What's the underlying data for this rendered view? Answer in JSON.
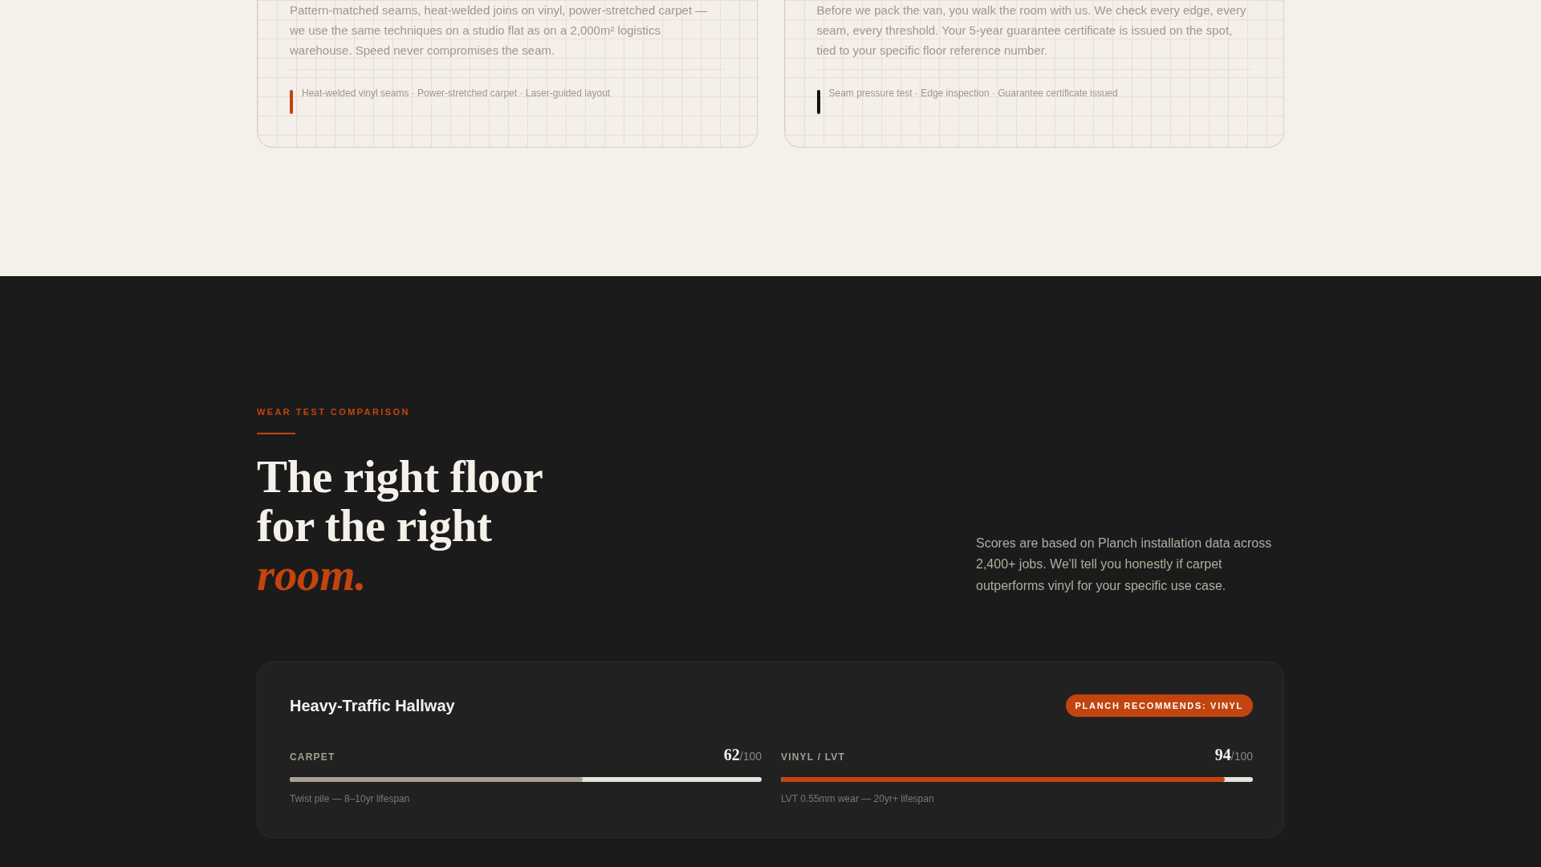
{
  "feature_cards": [
    {
      "text": "Pattern-matched seams, heat-welded joins on vinyl, power-stretched carpet — we use the same techniques on a studio flat as on a 2,000m² logistics warehouse. Speed never compromises the seam.",
      "highlights": "Heat-welded vinyl seams · Power-stretched carpet · Laser-guided layout",
      "color": "#c2440f"
    },
    {
      "text": "Before we pack the van, you walk the room with us. We check every edge, every seam, every threshold. Your 5-year guarantee certificate is issued on the spot, tied to your specific floor reference number.",
      "highlights": "Seam pressure test · Edge inspection · Guarantee certificate issued",
      "color": "#111111"
    }
  ],
  "wear_test": {
    "eyebrow": "WEAR TEST COMPARISON",
    "heading": "The right floor for the right *room.*",
    "description": "Scores are based on Planch installation data across 2,400+ jobs. We'll tell you honestly if carpet outperforms vinyl for your specific use case.",
    "comparison": {
      "title": "Heavy-Traffic Hallway",
      "badge": "PLANCH RECOMMENDS: VINYL",
      "scores": [
        {
          "label": "CARPET",
          "score": "62",
          "scale": "/100",
          "level": 0.62,
          "color": "#a89f94",
          "note": "Twist pile — 8–10yr lifespan"
        },
        {
          "label": "VINYL / LVT",
          "score": "94",
          "scale": "/100",
          "level": 0.94,
          "color": "#c2440f",
          "note": "LVT 0.55mm wear — 20yr+ lifespan"
        }
      ]
    }
  }
}
